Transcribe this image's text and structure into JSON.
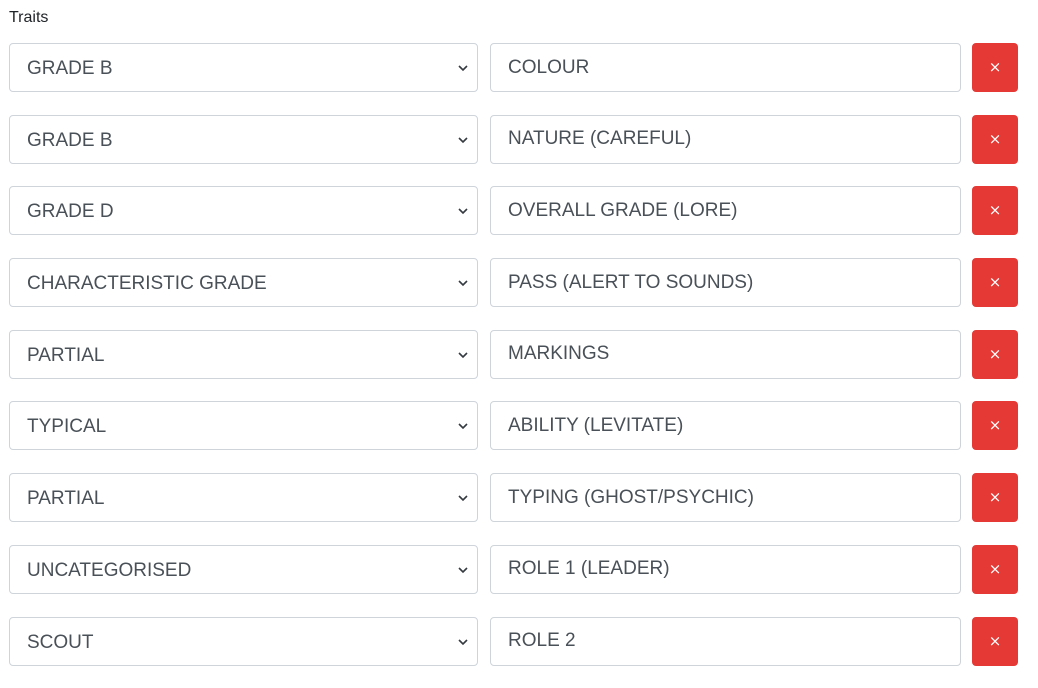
{
  "section": {
    "title": "Traits"
  },
  "traits": [
    {
      "grade": "GRADE B",
      "trait": "COLOUR",
      "remove_label": "×"
    },
    {
      "grade": "GRADE B",
      "trait": "NATURE (CAREFUL)",
      "remove_label": "×"
    },
    {
      "grade": "GRADE D",
      "trait": "OVERALL GRADE (LORE)",
      "remove_label": "×"
    },
    {
      "grade": "CHARACTERISTIC GRADE",
      "trait": "PASS (ALERT TO SOUNDS)",
      "remove_label": "×"
    },
    {
      "grade": "PARTIAL",
      "trait": "MARKINGS",
      "remove_label": "×"
    },
    {
      "grade": "TYPICAL",
      "trait": "ABILITY (LEVITATE)",
      "remove_label": "×"
    },
    {
      "grade": "PARTIAL",
      "trait": "TYPING (GHOST/PSYCHIC)",
      "remove_label": "×"
    },
    {
      "grade": "UNCATEGORISED",
      "trait": "ROLE 1 (LEADER)",
      "remove_label": "×"
    },
    {
      "grade": "SCOUT",
      "trait": "ROLE 2",
      "remove_label": "×"
    }
  ],
  "icons": {
    "dropdown": "chevron-down-icon",
    "remove": "close-icon"
  },
  "colors": {
    "remove_button": "#e53935",
    "border": "#ced4da",
    "text": "#495057"
  }
}
